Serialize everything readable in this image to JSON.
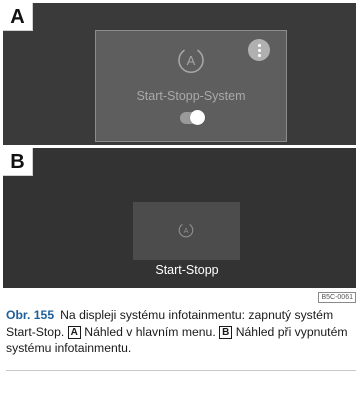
{
  "panel_a": {
    "label": "A",
    "tile_title": "Start-Stopp-System",
    "icon": "start-stop-icon",
    "menu_icon": "more-vertical-icon",
    "toggle_state": "on"
  },
  "panel_b": {
    "label": "B",
    "tile_label": "Start-Stopp",
    "icon": "start-stop-icon"
  },
  "figure_id": "B5C-0061",
  "caption": {
    "number": "Obr. 155",
    "part1": "Na displeji systému infotainmentu: zapnutý systém Start-Stop.",
    "tag_a": "A",
    "part2": "Náhled v hlavním menu.",
    "tag_b": "B",
    "part3": "Náhled při vypnutém systému infotainmentu."
  },
  "colors": {
    "panel_a_bg": "#3a3a3a",
    "panel_b_bg": "#333333",
    "caption_number": "#1f5f9a"
  }
}
